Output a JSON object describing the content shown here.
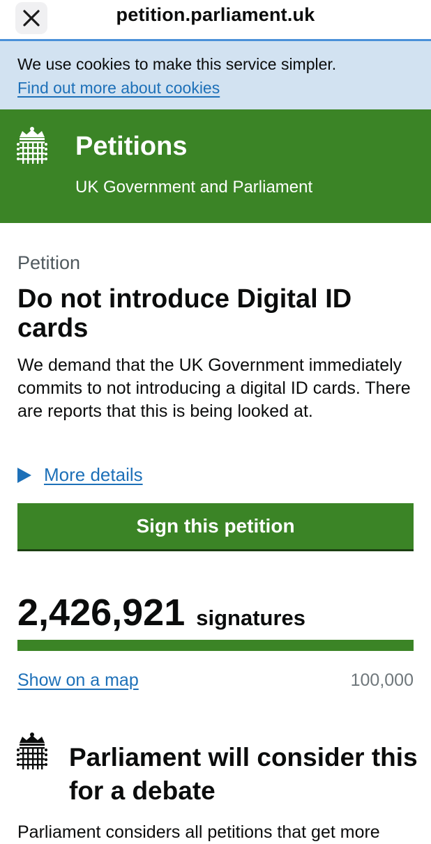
{
  "browser": {
    "url": "petition.parliament.uk"
  },
  "cookie_banner": {
    "text": "We use cookies to make this service simpler.",
    "link": "Find out more about cookies"
  },
  "header": {
    "title": "Petitions",
    "subtitle": "UK Government and Parliament"
  },
  "petition": {
    "caption": "Petition",
    "title": "Do not introduce Digital ID cards",
    "description": "We demand that the UK Government immediately commits to not introducing a digital ID cards. There are reports that this is being looked at.",
    "more_details": "More details",
    "sign_button": "Sign this petition",
    "signature_count": "2,426,921",
    "signature_label": "signatures",
    "progress_fraction": 1.0,
    "map_link": "Show on a map",
    "threshold": "100,000"
  },
  "debate": {
    "title": "Parliament will consider this for a debate",
    "body_partial": "Parliament considers all petitions that get more"
  },
  "colors": {
    "brand_green": "#3b8426",
    "link_blue": "#1d70b8",
    "cookie_bg": "#d2e2f1",
    "browser_accent": "#4a90d9"
  }
}
